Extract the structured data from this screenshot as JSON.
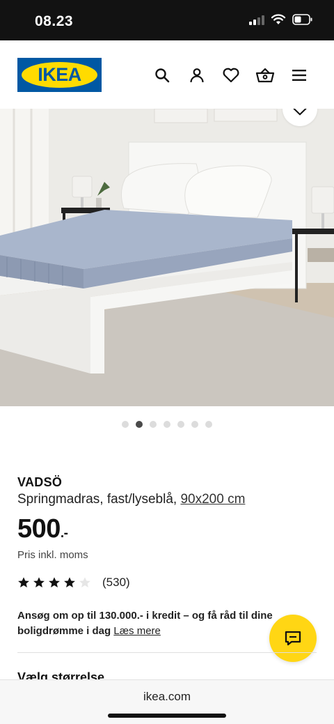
{
  "status_bar": {
    "time": "08.23"
  },
  "header": {
    "logo_text": "IKEA",
    "brand_colors": {
      "blue": "#0058a3",
      "yellow": "#ffdb00"
    },
    "icons": [
      "search-icon",
      "account-icon",
      "favourites-icon",
      "shopping-bag-icon",
      "menu-icon"
    ]
  },
  "gallery": {
    "image_count": 7,
    "active_index": 1
  },
  "product": {
    "name": "VADSÖ",
    "description": "Springmadras, fast/lyseblå,",
    "size": "90x200 cm",
    "price": "500",
    "price_suffix": ".-",
    "vat_note": "Pris inkl. moms",
    "rating_stars": 4,
    "rating_max": 5,
    "review_count": "(530)"
  },
  "credit": {
    "text": "Ansøg om op til 130.000.- i kredit – og få råd til dine boligdrømme i dag",
    "link": "Læs mere"
  },
  "section": {
    "size_title": "Vælg størrelse"
  },
  "browser": {
    "url": "ikea.com"
  },
  "chat": {
    "icon": "chat-icon",
    "color": "#ffd614"
  }
}
